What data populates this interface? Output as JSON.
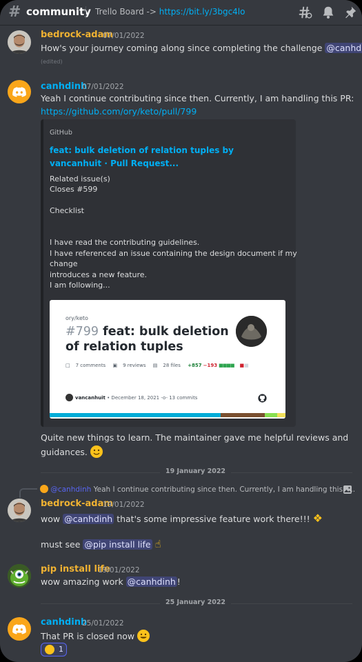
{
  "channel": {
    "hash_icon": "hash-icon",
    "name": "community"
  },
  "topic": {
    "prefix": "Trello Board -> ",
    "link": "https://bit.ly/3bgc4lo"
  },
  "toolbar": {
    "icons": [
      "threads-icon",
      "bell-icon",
      "pin-icon"
    ]
  },
  "messages": {
    "m1": {
      "author": "bedrock-adam",
      "author_color": "#f0b232",
      "timestamp": "07/01/2022",
      "text_before": "How's your journey coming along since completing the challenge ",
      "mention": "@canhdinh",
      "text_after": "?",
      "edited": "(edited)"
    },
    "m2": {
      "author": "canhdinh",
      "author_color": "#00aff4",
      "timestamp": "07/01/2022",
      "line1": "Yeah I continue contributing since then. Currently, I am handling this PR:",
      "link": "https://github.com/ory/keto/pull/799",
      "after1": "Quite new things to learn. The maintainer gave me helpful reviews and",
      "after2": "guidances."
    },
    "m3": {
      "author": "bedrock-adam",
      "author_color": "#f0b232",
      "timestamp": "19/01/2022",
      "reply_name": "@canhdinh",
      "reply_text": "Yeah I continue contributing since then. Currently, I am handling this P...",
      "l1_before": "wow ",
      "l1_mention": "@canhdinh",
      "l1_after": " that's some impressive feature work there!!!",
      "l2_before": "must see ",
      "l2_mention": "@pip install life"
    },
    "m4": {
      "author": "pip install life",
      "author_color": "#f0b232",
      "timestamp": "19/01/2022",
      "before": "wow amazing work ",
      "mention": "@canhdinh",
      "after": "!"
    },
    "m5": {
      "author": "canhdinh",
      "author_color": "#00aff4",
      "timestamp": "25/01/2022",
      "text": "That PR is closed now",
      "reaction_count": "1"
    }
  },
  "embed": {
    "provider": "GitHub",
    "title": "feat: bulk deletion of relation tuples by vancanhuit · Pull Request...",
    "desc": [
      "Related issue(s)",
      "Closes #599",
      "",
      "Checklist",
      "",
      "",
      "I have read the contributing guidelines.",
      "I have referenced an issue containing the design document if my",
      "change",
      "introduces a new feature.",
      "I am following..."
    ],
    "card": {
      "repo": "ory/keto",
      "number": "#799",
      "title": "feat: bulk deletion of relation tuples",
      "comments": "7 comments",
      "reviews": "9 reviews",
      "files": "28 files",
      "additions": "+857",
      "deletions": "−193",
      "author": "vancanhuit",
      "date": "• December 18, 2021",
      "commits": "13 commits"
    }
  },
  "dividers": {
    "d1": "19 January 2022",
    "d2": "25 January 2022"
  }
}
